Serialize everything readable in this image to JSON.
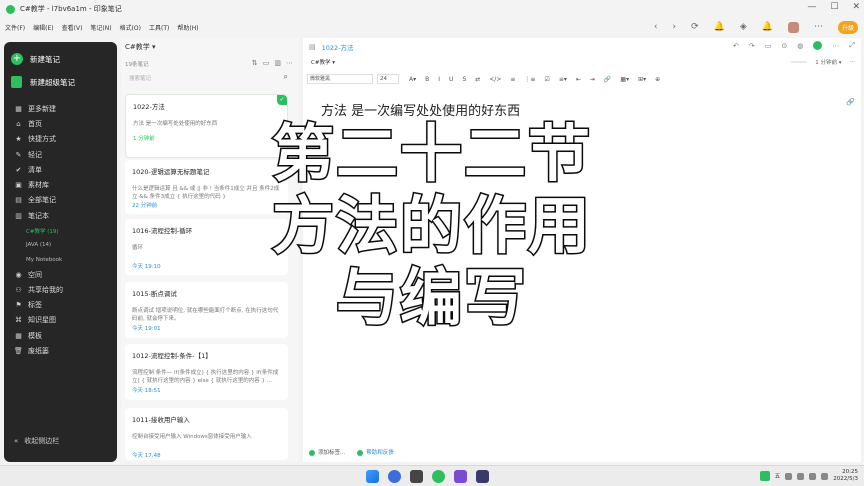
{
  "window": {
    "title": "C#教学 - l7bv6a1m - 印象笔记",
    "controls": [
      "—",
      "☐",
      "✕"
    ]
  },
  "menu": [
    "文件(F)",
    "编辑(E)",
    "查看(V)",
    "笔记(N)",
    "格式(O)",
    "工具(T)",
    "帮助(H)"
  ],
  "topbar": {
    "back": "‹",
    "forward": "›",
    "sync": "⟳",
    "notify": "🔔",
    "shield": "◈",
    "bell": "🔔",
    "menu": "⋯",
    "upgrade_label": "升级"
  },
  "sidebar": {
    "new_note_label": "新建笔记",
    "new_super_note_label": "新建超级笔记",
    "items": [
      {
        "icon": "▦",
        "label": "更多新建"
      },
      {
        "icon": "⌂",
        "label": "首页"
      },
      {
        "icon": "★",
        "label": "快捷方式"
      },
      {
        "icon": "✎",
        "label": "轻记"
      },
      {
        "icon": "✔",
        "label": "清单"
      },
      {
        "icon": "▣",
        "label": "素材库"
      },
      {
        "icon": "▤",
        "label": "全部笔记"
      },
      {
        "icon": "▥",
        "label": "笔记本"
      }
    ],
    "notebooks": [
      {
        "label": "C#教学  (19)",
        "active": true
      },
      {
        "label": "JAVA  (14)",
        "active": false
      },
      {
        "label": "My Notebook",
        "active": false
      }
    ],
    "items2": [
      {
        "icon": "◉",
        "label": "空间"
      },
      {
        "icon": "⚇",
        "label": "共享给我的"
      },
      {
        "icon": "⚑",
        "label": "标签"
      },
      {
        "icon": "⌘",
        "label": "知识星图"
      },
      {
        "icon": "▦",
        "label": "模板"
      },
      {
        "icon": "🗑",
        "label": "废纸篓"
      }
    ],
    "collapse_label": "收起侧边栏"
  },
  "notelist": {
    "notebook_name": "C#教学 ▾",
    "count": "19条笔记",
    "search_placeholder": "搜索笔记",
    "notes": [
      {
        "title": "1022-方法",
        "snippet": "方法 是一次编写处处使用的好东西",
        "time": "1 分钟前"
      },
      {
        "title": "1020-逻辑运算无标题笔记",
        "snippet": "什么是逻辑运算 且 && 或 || 非 ! 当条件1成立 并且 条件2成立 && 条件3成立 { 执行这里的代码 }",
        "time": "22 分钟前"
      },
      {
        "title": "1016-流程控制-循环",
        "snippet": "循环",
        "time": "今天 19:10"
      },
      {
        "title": "1015-断点调试",
        "snippet": "断点调试 增项说明位, 就在哪些能面打个断点, 在执行这句代码前, 就会停下来。",
        "time": "今天 19:01"
      },
      {
        "title": "1012-流程控制-条件-【1】",
        "snippet": "流程控制 条件— if(条件成立) { 执行这里的内容 } if(条件成立) { 就执行这里的内容 } else { 就执行这里的内容 } ...",
        "time": "今天 18:51"
      },
      {
        "title": "1011-接收用户输入",
        "snippet": "控制台接受用户输入 Windows窗体接受用户输入",
        "time": "今天 17:48"
      }
    ]
  },
  "editor": {
    "breadcrumb": "1022-方法",
    "notebook": "C#教学 ▾",
    "status_pill": "",
    "edited": "1 分钟前 ▾",
    "font": "微软雅黑",
    "size": "24",
    "toolbar_glyphs": [
      "A▾",
      "B",
      "I",
      "U",
      "S",
      "⇄",
      "</>",
      "≡",
      "⋮≡",
      "☑",
      "≡▾",
      "⇤",
      "⇥",
      "🔗",
      "▦▾",
      "⊞▾",
      "⊕"
    ],
    "body": "方法 是一次编写处处使用的好东西",
    "footer_tag": "添加标签...",
    "footer_help": "帮助和反馈"
  },
  "overlay": {
    "line1": "第二十二节",
    "line2": "方法的作用",
    "line3": "与编写"
  },
  "taskbar": {
    "time": "20:25",
    "date": "2022/5/3",
    "ime": "五"
  }
}
